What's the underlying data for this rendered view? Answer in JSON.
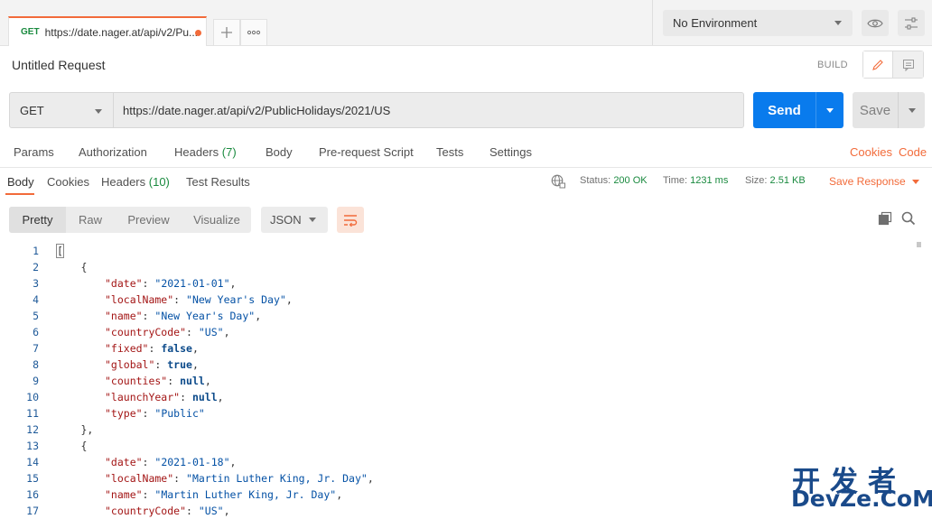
{
  "tabbar": {
    "tab": {
      "method": "GET",
      "url": "https://date.nager.at/api/v2/Pu..."
    },
    "new_tab_icon": "plus-icon",
    "more_tabs_icon": "ellipsis-icon",
    "environment": "No Environment"
  },
  "request": {
    "title": "Untitled Request",
    "build_label": "BUILD",
    "method": "GET",
    "url": "https://date.nager.at/api/v2/PublicHolidays/2021/US",
    "send_label": "Send",
    "save_label": "Save"
  },
  "request_tabs": [
    {
      "label": "Params"
    },
    {
      "label": "Authorization"
    },
    {
      "label": "Headers",
      "count": "(7)"
    },
    {
      "label": "Body"
    },
    {
      "label": "Pre-request Script"
    },
    {
      "label": "Tests"
    },
    {
      "label": "Settings"
    }
  ],
  "request_links": {
    "cookies": "Cookies",
    "code": "Code"
  },
  "response_tabs": [
    {
      "label": "Body"
    },
    {
      "label": "Cookies"
    },
    {
      "label": "Headers",
      "count": "(10)"
    },
    {
      "label": "Test Results"
    }
  ],
  "response_status": {
    "status_label": "Status:",
    "status_value": "200 OK",
    "time_label": "Time:",
    "time_value": "1231 ms",
    "size_label": "Size:",
    "size_value": "2.51 KB",
    "save_response": "Save Response"
  },
  "view_options": [
    "Pretty",
    "Raw",
    "Preview",
    "Visualize"
  ],
  "format": "JSON",
  "code_lines": [
    {
      "n": "1",
      "indent": 0,
      "parts": [
        {
          "t": "p",
          "v": "["
        }
      ]
    },
    {
      "n": "2",
      "indent": 1,
      "parts": [
        {
          "t": "p",
          "v": "{"
        }
      ]
    },
    {
      "n": "3",
      "indent": 2,
      "parts": [
        {
          "t": "k",
          "v": "\"date\""
        },
        {
          "t": "p",
          "v": ": "
        },
        {
          "t": "s",
          "v": "\"2021-01-01\""
        },
        {
          "t": "p",
          "v": ","
        }
      ]
    },
    {
      "n": "4",
      "indent": 2,
      "parts": [
        {
          "t": "k",
          "v": "\"localName\""
        },
        {
          "t": "p",
          "v": ": "
        },
        {
          "t": "s",
          "v": "\"New Year's Day\""
        },
        {
          "t": "p",
          "v": ","
        }
      ]
    },
    {
      "n": "5",
      "indent": 2,
      "parts": [
        {
          "t": "k",
          "v": "\"name\""
        },
        {
          "t": "p",
          "v": ": "
        },
        {
          "t": "s",
          "v": "\"New Year's Day\""
        },
        {
          "t": "p",
          "v": ","
        }
      ]
    },
    {
      "n": "6",
      "indent": 2,
      "parts": [
        {
          "t": "k",
          "v": "\"countryCode\""
        },
        {
          "t": "p",
          "v": ": "
        },
        {
          "t": "s",
          "v": "\"US\""
        },
        {
          "t": "p",
          "v": ","
        }
      ]
    },
    {
      "n": "7",
      "indent": 2,
      "parts": [
        {
          "t": "k",
          "v": "\"fixed\""
        },
        {
          "t": "p",
          "v": ": "
        },
        {
          "t": "b",
          "v": "false"
        },
        {
          "t": "p",
          "v": ","
        }
      ]
    },
    {
      "n": "8",
      "indent": 2,
      "parts": [
        {
          "t": "k",
          "v": "\"global\""
        },
        {
          "t": "p",
          "v": ": "
        },
        {
          "t": "b",
          "v": "true"
        },
        {
          "t": "p",
          "v": ","
        }
      ]
    },
    {
      "n": "9",
      "indent": 2,
      "parts": [
        {
          "t": "k",
          "v": "\"counties\""
        },
        {
          "t": "p",
          "v": ": "
        },
        {
          "t": "b",
          "v": "null"
        },
        {
          "t": "p",
          "v": ","
        }
      ]
    },
    {
      "n": "10",
      "indent": 2,
      "parts": [
        {
          "t": "k",
          "v": "\"launchYear\""
        },
        {
          "t": "p",
          "v": ": "
        },
        {
          "t": "b",
          "v": "null"
        },
        {
          "t": "p",
          "v": ","
        }
      ]
    },
    {
      "n": "11",
      "indent": 2,
      "parts": [
        {
          "t": "k",
          "v": "\"type\""
        },
        {
          "t": "p",
          "v": ": "
        },
        {
          "t": "s",
          "v": "\"Public\""
        }
      ]
    },
    {
      "n": "12",
      "indent": 1,
      "parts": [
        {
          "t": "p",
          "v": "},"
        }
      ]
    },
    {
      "n": "13",
      "indent": 1,
      "parts": [
        {
          "t": "p",
          "v": "{"
        }
      ]
    },
    {
      "n": "14",
      "indent": 2,
      "parts": [
        {
          "t": "k",
          "v": "\"date\""
        },
        {
          "t": "p",
          "v": ": "
        },
        {
          "t": "s",
          "v": "\"2021-01-18\""
        },
        {
          "t": "p",
          "v": ","
        }
      ]
    },
    {
      "n": "15",
      "indent": 2,
      "parts": [
        {
          "t": "k",
          "v": "\"localName\""
        },
        {
          "t": "p",
          "v": ": "
        },
        {
          "t": "s",
          "v": "\"Martin Luther King, Jr. Day\""
        },
        {
          "t": "p",
          "v": ","
        }
      ]
    },
    {
      "n": "16",
      "indent": 2,
      "parts": [
        {
          "t": "k",
          "v": "\"name\""
        },
        {
          "t": "p",
          "v": ": "
        },
        {
          "t": "s",
          "v": "\"Martin Luther King, Jr. Day\""
        },
        {
          "t": "p",
          "v": ","
        }
      ]
    },
    {
      "n": "17",
      "indent": 2,
      "parts": [
        {
          "t": "k",
          "v": "\"countryCode\""
        },
        {
          "t": "p",
          "v": ": "
        },
        {
          "t": "s",
          "v": "\"US\""
        },
        {
          "t": "p",
          "v": ","
        }
      ]
    }
  ],
  "watermark": {
    "line1": "开发者",
    "line2": "DevZe.CoM"
  },
  "colors": {
    "accent": "#f26b3a",
    "send": "#097bed",
    "success": "#1a8a3f"
  }
}
